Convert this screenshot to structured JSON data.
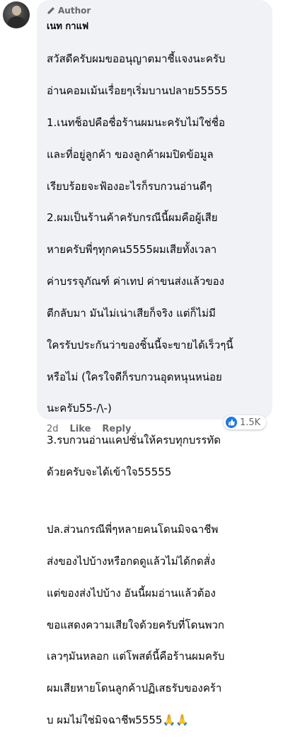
{
  "comment": {
    "badge_label": "Author",
    "author_name": "เนท กาแฟ",
    "paragraphs": [
      {
        "lines": [
          "สวัสดีครับผมขออนุญาตมาชี้แจงนะครับ",
          "อ่านคอมเม้นเรื่อยๆเริ่มบานปลาย55555",
          "1.เนทช็อปคือชื่อร้านผมนะครับไม่ใช่ชื่อ",
          "และที่อยู่ลูกค้า ของลูกค้าผมปิดข้อมูล",
          "เรียบร้อยจะฟ้องอะไรก็รบกวนอ่านดีๆ",
          "2.ผมเป็นร้านค้าครับกรณีนี้ผมคือผู้เสีย",
          "หายครับพี่ๆทุกคน5555ผมเสียทั้งเวลา",
          "ค่าบรรจุภัณฑ์ ค่าเทป ค่าขนส่งแล้วของ",
          "ตีกลับมา มันไม่เน่าเสียก็จริง แต่ก็ไม่มี",
          "ใครรับประกันว่าของชิ้นนี้จะขายได้เร็วๆนี้",
          "หรือไม่ (ใครใจดีก็รบกวนอุดหนุนหน่อย",
          "นะครับ55-/\\-)",
          "3.รบกวนอ่านแคปชั่นให้ครบทุกบรรทัด",
          "ด้วยครับจะได้เข้าใจ55555"
        ]
      },
      {
        "lines": [
          "ปล.ส่วนกรณีพี่ๆหลายคนโดนมิจฉาชีพ",
          "ส่งของไปบ้างหรือกดดูแล้วไม่ได้กดสั่ง",
          "แต่ของส่งไปบ้าง อันนี้ผมอ่านแล้วต้อง",
          "ขอแสดงความเสียใจด้วยครับที่โดนพวก",
          "เลวๆมันหลอก แต่โพสต์นี้คือร้านผมครับ",
          "ผมเสียหายโดนลูกค้าปฏิเสธรับของคร้า",
          "บ ผมไม่ใช่มิจฉาชีพ5555🙏🙏"
        ]
      }
    ],
    "time_ago": "2d",
    "like_label": "Like",
    "reply_label": "Reply",
    "reaction_count": "1.5K",
    "reaction_icon": "thumbs-up-icon",
    "colors": {
      "bubble": "#f0f2f5",
      "meta_text": "#65676b",
      "like_blue": "#1877f2"
    }
  }
}
